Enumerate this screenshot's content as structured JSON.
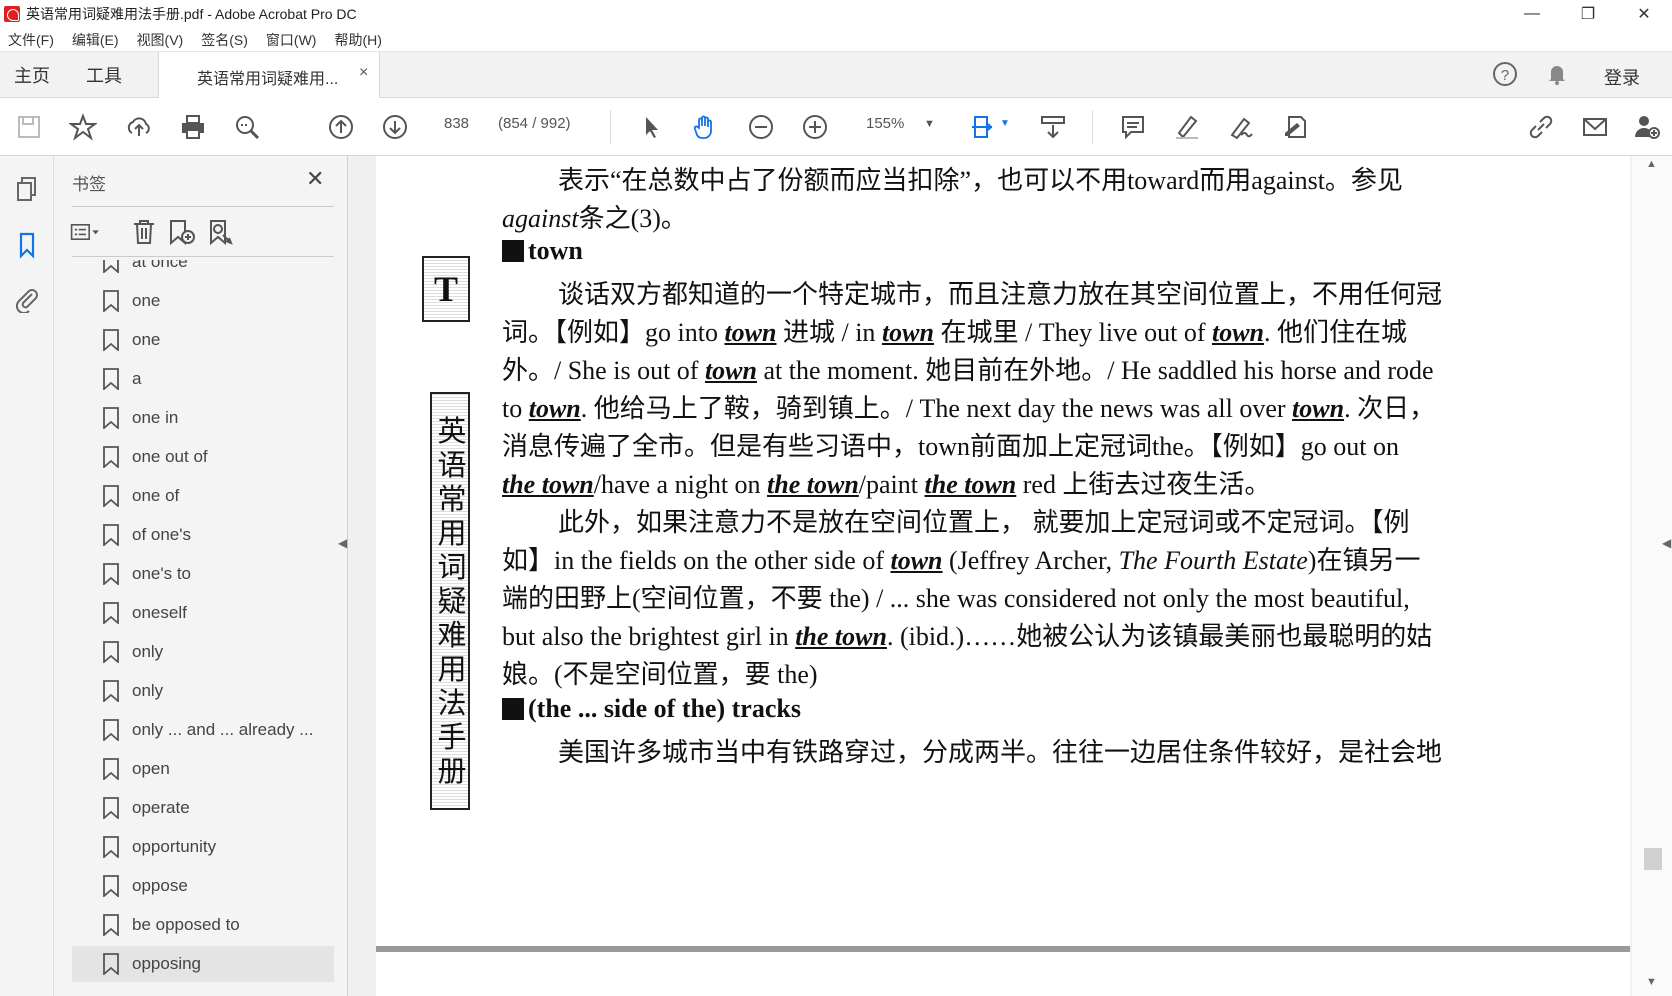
{
  "window": {
    "title": "英语常用词疑难用法手册.pdf - Adobe Acrobat Pro DC",
    "minimize": "—",
    "maximize": "❐",
    "close": "✕"
  },
  "menu": [
    "文件(F)",
    "编辑(E)",
    "视图(V)",
    "签名(S)",
    "窗口(W)",
    "帮助(H)"
  ],
  "tabs": {
    "home": "主页",
    "tools": "工具",
    "document": "英语常用词疑难用...",
    "document_close": "×",
    "login": "登录"
  },
  "toolbar": {
    "page_current": "838",
    "page_total": "(854 / 992)",
    "zoom": "155%"
  },
  "bookmarks": {
    "header": "书签",
    "close": "✕",
    "items": [
      {
        "label": "at once"
      },
      {
        "label": "one"
      },
      {
        "label": "one"
      },
      {
        "label": "a"
      },
      {
        "label": "one in"
      },
      {
        "label": "one out of"
      },
      {
        "label": "one of"
      },
      {
        "label": "of one's"
      },
      {
        "label": "one's to"
      },
      {
        "label": "oneself"
      },
      {
        "label": "only"
      },
      {
        "label": "only"
      },
      {
        "label": "only ... and ... already ..."
      },
      {
        "label": "open"
      },
      {
        "label": "operate"
      },
      {
        "label": "opportunity"
      },
      {
        "label": "oppose"
      },
      {
        "label": "be opposed to"
      },
      {
        "label": "opposing"
      }
    ],
    "selected": "opposing"
  },
  "document": {
    "side_letter": "T",
    "side_title": "英语常用词疑难用法手册",
    "l1a": "表示“在总数中占了份额而应当扣除”，也可以不用toward而用against。参见",
    "l2a": "against",
    "l2b": "条之(3)。",
    "h1": "town",
    "p1l1": "谈话双方都知道的一个特定城市，而且注意力放在其空间位置上，不用任何冠",
    "p1l2a": "词。【例如】go into ",
    "p1l2b": "town",
    "p1l2c": " 进城 / in ",
    "p1l2d": "town",
    "p1l2e": " 在城里 / They live out of ",
    "p1l2f": "town",
    "p1l2g": ". 他们住在城",
    "p1l3a": "外。/ She is out of ",
    "p1l3b": "town",
    "p1l3c": " at the moment. 她目前在外地。/ He saddled his horse and rode",
    "p1l4a": "to ",
    "p1l4b": "town",
    "p1l4c": ". 他给马上了鞍，骑到镇上。/ The next day the news was all over ",
    "p1l4d": "town",
    "p1l4e": ". 次日，",
    "p1l5": "消息传遍了全市。但是有些习语中，town前面加上定冠词the。【例如】go out on",
    "p1l6a": "the town",
    "p1l6b": "/have a night on ",
    "p1l6c": "the town",
    "p1l6d": "/paint ",
    "p1l6e": "the town",
    "p1l6f": " red 上街去过夜生活。",
    "p2l1": "此外，如果注意力不是放在空间位置上， 就要加上定冠词或不定冠词。【例",
    "p2l2a": "如】in the fields on the other side of ",
    "p2l2b": "town",
    "p2l2c": " (Jeffrey Archer, ",
    "p2l2d": "The Fourth Estate",
    "p2l2e": ")在镇另一",
    "p2l3": "端的田野上(空间位置，不要 the) / ... she was considered not only the most beautiful,",
    "p2l4a": "but also the brightest girl in ",
    "p2l4b": "the town",
    "p2l4c": ". (ibid.)……她被公认为该镇最美丽也最聪明的姑",
    "p2l5": "娘。(不是空间位置，要 the)",
    "h2": "(the ... side of the) tracks",
    "p3l1": "美国许多城市当中有铁路穿过，分成两半。往往一边居住条件较好，是社会地"
  },
  "colors": {
    "accent_blue": "#1473e6",
    "panel_bg": "#f4f4f4",
    "doc_bg": "#f0f0f0"
  },
  "icons": [
    "save-icon",
    "star-icon",
    "upload-icon",
    "print-icon",
    "zoom-search-icon",
    "page-up-icon",
    "page-down-icon",
    "select-arrow-icon",
    "hand-icon",
    "zoom-out-icon",
    "zoom-in-icon",
    "fit-page-icon",
    "scroll-mode-icon",
    "comment-icon",
    "highlight-icon",
    "sign-icon",
    "edit-icon",
    "share-link-icon",
    "email-icon",
    "add-user-icon",
    "help-icon",
    "bell-icon",
    "pages-icon",
    "bookmark-icon",
    "attachment-icon"
  ]
}
